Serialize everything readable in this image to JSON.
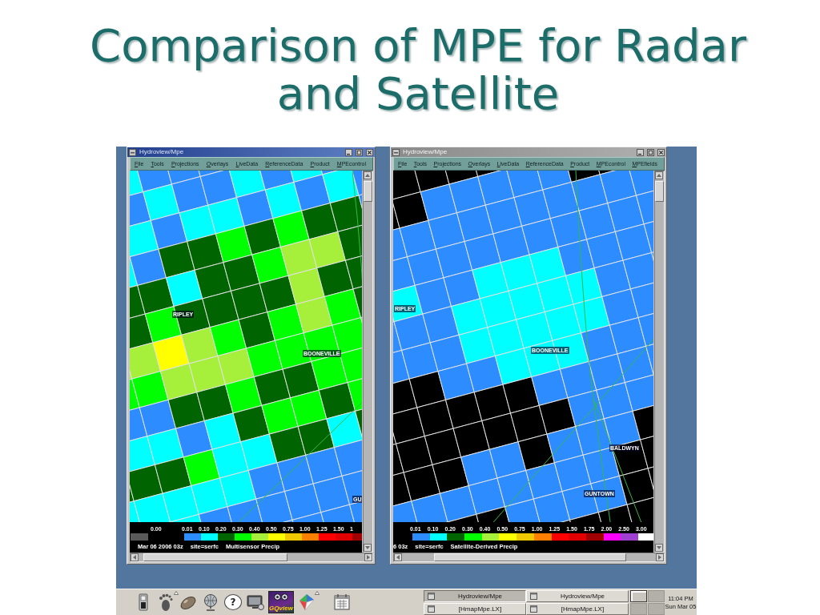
{
  "slide": {
    "title": "Comparison of MPE for Radar and Satellite"
  },
  "windows": [
    {
      "title": "Hydroview/Mpe",
      "active": true,
      "menu": [
        "File",
        "Tools",
        "Projections",
        "Overlays",
        "LiveData",
        "ReferenceData",
        "Product",
        "MPEcontrol"
      ],
      "map_labels": [
        "RIPLEY",
        "BOONEVILLE",
        "GU"
      ],
      "legend": [
        {
          "kind": "no_data",
          "label": "0.00",
          "color": "#5a5a5a"
        },
        {
          "kind": "range",
          "label": "0.01",
          "color": "#2d8cff"
        },
        {
          "kind": "range",
          "label": "0.10",
          "color": "#00ffff"
        },
        {
          "kind": "range",
          "label": "0.20",
          "color": "#006400"
        },
        {
          "kind": "range",
          "label": "0.30",
          "color": "#00ff00"
        },
        {
          "kind": "range",
          "label": "0.40",
          "color": "#a6ef3a"
        },
        {
          "kind": "range",
          "label": "0.50",
          "color": "#ffff00"
        },
        {
          "kind": "range",
          "label": "0.75",
          "color": "#f0c800"
        },
        {
          "kind": "range",
          "label": "1.00",
          "color": "#ff8000"
        },
        {
          "kind": "range",
          "label": "1.25",
          "color": "#ff0000"
        },
        {
          "kind": "range",
          "label": "1.50",
          "color": "#e00000"
        },
        {
          "kind": "range",
          "label": "1",
          "color": "#a00000"
        }
      ],
      "footer": [
        "Mar 06 2006 03z",
        "site=serfc",
        "Multisensor Precip"
      ]
    },
    {
      "title": "Hydroview/Mpe",
      "active": false,
      "menu": [
        "File",
        "Tools",
        "Projections",
        "Overlays",
        "LiveData",
        "ReferenceData",
        "Product",
        "MPEcontrol",
        "MPEfields"
      ],
      "map_labels": [
        "RIPLEY",
        "BOONEVILLE",
        "BALDWYN",
        "GUNTOWN"
      ],
      "legend": [
        {
          "kind": "range",
          "label": "0.01",
          "color": "#2d8cff"
        },
        {
          "kind": "range",
          "label": "0.10",
          "color": "#00ffff"
        },
        {
          "kind": "range",
          "label": "0.20",
          "color": "#006400"
        },
        {
          "kind": "range",
          "label": "0.30",
          "color": "#00ff00"
        },
        {
          "kind": "range",
          "label": "0.40",
          "color": "#a6ef3a"
        },
        {
          "kind": "range",
          "label": "0.50",
          "color": "#ffff00"
        },
        {
          "kind": "range",
          "label": "0.75",
          "color": "#f0c800"
        },
        {
          "kind": "range",
          "label": "1.00",
          "color": "#ff8000"
        },
        {
          "kind": "range",
          "label": "1.25",
          "color": "#ff0000"
        },
        {
          "kind": "range",
          "label": "1.50",
          "color": "#e00000"
        },
        {
          "kind": "range",
          "label": "1.75",
          "color": "#a00000"
        },
        {
          "kind": "range",
          "label": "2.00",
          "color": "#ff00ff"
        },
        {
          "kind": "range",
          "label": "2.50",
          "color": "#a040d0"
        },
        {
          "kind": "range",
          "label": "3.00",
          "color": "#ffffff"
        }
      ],
      "footer": [
        "6 03z",
        "site=serfc",
        "Satellite-Derived Precip"
      ]
    }
  ],
  "taskbar": {
    "help_glyph": "?",
    "app_caption": "GQview",
    "tasks": [
      {
        "title": "Hydroview/Mpe",
        "selected": true
      },
      {
        "title": "Hydroview/Mpe",
        "selected": false
      },
      {
        "title": "[HmapMpe.LX]",
        "selected": false
      },
      {
        "title": "[HmapMpe.LX]",
        "selected": false
      }
    ],
    "workspaces": [
      {
        "selected": true
      },
      {
        "selected": false
      },
      {
        "selected": false
      },
      {
        "selected": false
      }
    ],
    "clock": {
      "time": "11:04 PM",
      "date": "Sun Mar 05"
    }
  }
}
